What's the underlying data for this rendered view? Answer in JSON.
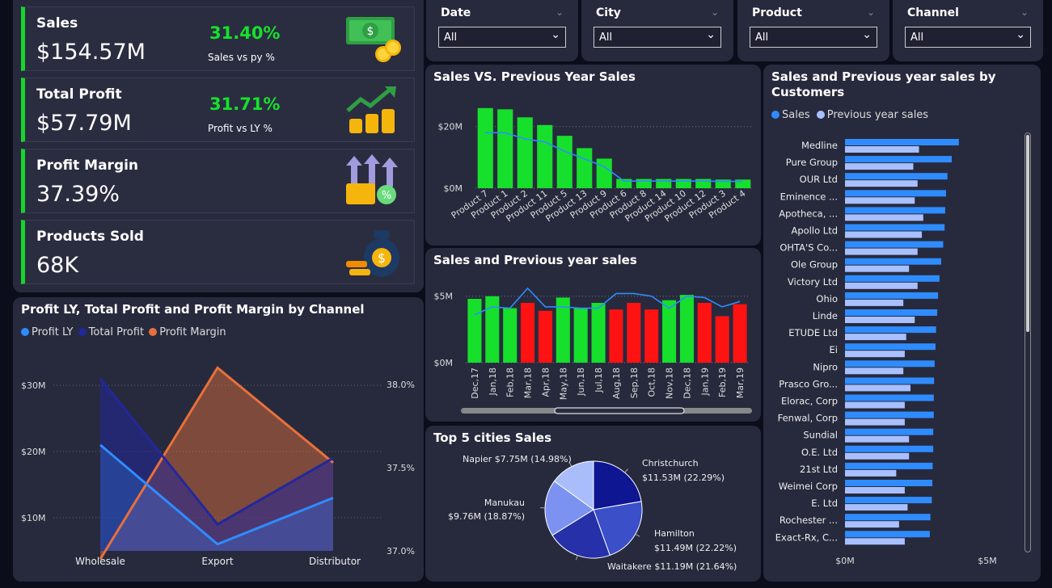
{
  "kpis": [
    {
      "title": "Sales",
      "value": "$154.57M",
      "pct": "31.40%",
      "sub": "Sales vs py %",
      "icon": "money-bills-coins-icon"
    },
    {
      "title": "Total Profit",
      "value": "$57.79M",
      "pct": "31.71%",
      "sub": "Profit vs LY %",
      "icon": "growth-coins-icon"
    },
    {
      "title": "Profit Margin",
      "value": "37.39%",
      "pct": "",
      "sub": "",
      "icon": "percent-coins-icon"
    },
    {
      "title": "Products Sold",
      "value": "68K",
      "pct": "",
      "sub": "",
      "icon": "money-bag-icon"
    }
  ],
  "filters": [
    {
      "label": "Date",
      "value": "All"
    },
    {
      "label": "City",
      "value": "All"
    },
    {
      "label": "Product",
      "value": "All"
    },
    {
      "label": "Channel",
      "value": "All"
    }
  ],
  "colors": {
    "green": "#16e02c",
    "red": "#ff1212",
    "blue": "#2f8cff",
    "lightBlue": "#a8c0ff",
    "navy": "#23279c",
    "orange": "#e8703a"
  },
  "chart_data": [
    {
      "id": "svp",
      "type": "bar",
      "title": "Sales VS. Previous Year Sales",
      "categories": [
        "Product 7",
        "Product 1",
        "Product 2",
        "Product 11",
        "Product 5",
        "Product 13",
        "Product 9",
        "Product 6",
        "Product 8",
        "Product 14",
        "Product 10",
        "Product 12",
        "Product 3",
        "Product 4"
      ],
      "series": [
        {
          "name": "Sales",
          "values": [
            26,
            25.6,
            23,
            20.5,
            17,
            13,
            9.6,
            3,
            3,
            3,
            3,
            3,
            2.8,
            2.8
          ]
        },
        {
          "name": "Previous Year Sales",
          "values": [
            18,
            18,
            16,
            15,
            12,
            9.5,
            7,
            2.3,
            2.3,
            2.3,
            2.3,
            2.3,
            2.2,
            2.2
          ]
        }
      ],
      "yticks": [
        "$20M",
        "$0M"
      ],
      "ylim": [
        0,
        27
      ]
    },
    {
      "id": "monthly",
      "type": "bar",
      "title": "Sales and Previous year sales",
      "categories": [
        "Dec,17",
        "Jan,18",
        "Feb,18",
        "Mar,18",
        "Apr,18",
        "May,18",
        "Jun,18",
        "Jul,18",
        "Aug,18",
        "Sep,18",
        "Oct,18",
        "Nov,18",
        "Dec,18",
        "Jan,19",
        "Feb,19",
        "Mar,19"
      ],
      "series": [
        {
          "name": "Sales",
          "values": [
            4.8,
            5.0,
            4.1,
            4.5,
            3.9,
            4.9,
            4.1,
            4.5,
            4.0,
            4.5,
            4.0,
            4.7,
            5.1,
            4.5,
            3.5,
            4.4
          ]
        },
        {
          "name": "Previous year sales",
          "values": [
            3.6,
            4.2,
            4.1,
            5.6,
            4.2,
            4.2,
            4.1,
            4.1,
            5.2,
            5.2,
            5.0,
            4.1,
            5.0,
            4.9,
            4.2,
            4.6
          ]
        }
      ],
      "bar_colors": [
        "g",
        "g",
        "g",
        "r",
        "r",
        "g",
        "g",
        "g",
        "r",
        "r",
        "r",
        "g",
        "g",
        "r",
        "r",
        "r"
      ],
      "yticks": [
        "$5M",
        "$0M"
      ],
      "ylim": [
        0,
        6.2
      ]
    },
    {
      "id": "cities",
      "type": "pie",
      "title": "Top 5 cities Sales",
      "slices": [
        {
          "name": "Christchurch",
          "value": 11.53,
          "label": "$11.53M (22.29%)",
          "color": "#0e1692"
        },
        {
          "name": "Hamilton",
          "value": 11.49,
          "label": "$11.49M (22.22%)",
          "color": "#3b4fc8"
        },
        {
          "name": "Waitakere",
          "value": 11.19,
          "label": "$11.19M (21.64%)",
          "color": "#2630a8"
        },
        {
          "name": "Manukau",
          "value": 9.76,
          "label": "$9.76M (18.87%)",
          "color": "#7b92f0"
        },
        {
          "name": "Napier",
          "value": 7.75,
          "label": "$7.75M (14.98%)",
          "color": "#a9bdfa"
        }
      ]
    },
    {
      "id": "customers",
      "type": "bar",
      "title": "Sales and Previous year sales by Customers",
      "legend": [
        "Sales",
        "Previous year sales"
      ],
      "categories": [
        "Medline",
        "Pure Group",
        "OUR Ltd",
        "Eminence ...",
        "Apotheca, ...",
        "Apollo Ltd",
        "OHTA'S Co...",
        "Ole Group",
        "Victory Ltd",
        "Ohio",
        "Linde",
        "ETUDE Ltd",
        "Ei",
        "Nipro",
        "Prasco Gro...",
        "Elorac, Corp",
        "Fenwal, Corp",
        "Sundial",
        "O.E. Ltd",
        "21st Ltd",
        "Weimei Corp",
        "E. Ltd",
        "Rochester ...",
        "Exact-Rx, C..."
      ],
      "series": [
        {
          "name": "Sales",
          "values": [
            4.0,
            3.75,
            3.6,
            3.55,
            3.52,
            3.5,
            3.45,
            3.38,
            3.32,
            3.27,
            3.24,
            3.2,
            3.18,
            3.15,
            3.13,
            3.12,
            3.12,
            3.1,
            3.1,
            3.08,
            3.07,
            3.05,
            3.0,
            2.98
          ]
        },
        {
          "name": "Previous year sales",
          "values": [
            2.6,
            2.4,
            2.55,
            2.45,
            2.75,
            2.7,
            2.55,
            2.25,
            2.55,
            2.05,
            2.45,
            2.15,
            2.1,
            2.05,
            2.3,
            2.1,
            2.1,
            2.25,
            2.25,
            1.8,
            2.1,
            2.2,
            1.9,
            2.1
          ]
        }
      ],
      "xticks": [
        "$0M",
        "$5M"
      ],
      "xlim": [
        0,
        5
      ]
    },
    {
      "id": "channel",
      "type": "area",
      "title": "Profit LY, Total Profit and Profit Margin by Channel",
      "legend": [
        "Profit LY",
        "Total Profit",
        "Profit Margin"
      ],
      "categories": [
        "Wholesale",
        "Export",
        "Distributor"
      ],
      "series": [
        {
          "name": "Profit LY",
          "values": [
            21,
            6,
            13
          ]
        },
        {
          "name": "Total Profit",
          "values": [
            31,
            9,
            19
          ]
        },
        {
          "name": "Profit Margin",
          "values": [
            36.95,
            38.1,
            37.53
          ]
        }
      ],
      "yticks_left": [
        "$30M",
        "$20M",
        "$10M"
      ],
      "yticks_right": [
        "38.0%",
        "37.5%",
        "37.0%"
      ]
    }
  ]
}
